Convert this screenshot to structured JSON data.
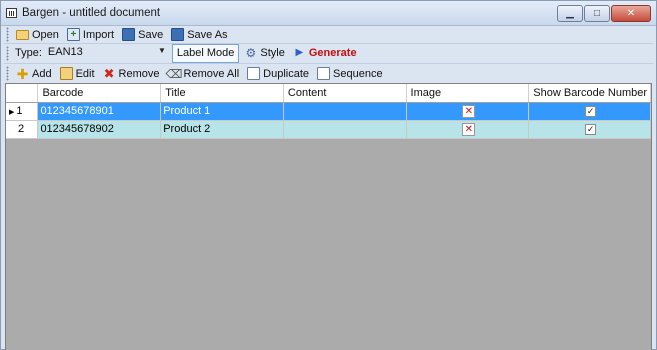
{
  "window": {
    "title": "Bargen - untitled document",
    "controls": {
      "minimize": "▁",
      "maximize": "□",
      "close": "✕"
    }
  },
  "toolbar1": {
    "open": "Open",
    "import": "Import",
    "save": "Save",
    "save_as": "Save As"
  },
  "toolbar2": {
    "type_label": "Type:",
    "type_value": "EAN13",
    "label_mode": "Label Mode",
    "style": "Style",
    "generate": "Generate"
  },
  "toolbar3": {
    "add": "Add",
    "edit": "Edit",
    "remove": "Remove",
    "remove_all": "Remove All",
    "duplicate": "Duplicate",
    "sequence": "Sequence"
  },
  "grid": {
    "columns": [
      "Barcode",
      "Title",
      "Content",
      "Image",
      "Show Barcode Number"
    ],
    "rows": [
      {
        "index": "1",
        "barcode": "012345678901",
        "title": "Product 1",
        "content": "",
        "image": "✕",
        "show_number": "✓"
      },
      {
        "index": "2",
        "barcode": "012345678902",
        "title": "Product 2",
        "content": "",
        "image": "✕",
        "show_number": "✓"
      }
    ]
  }
}
